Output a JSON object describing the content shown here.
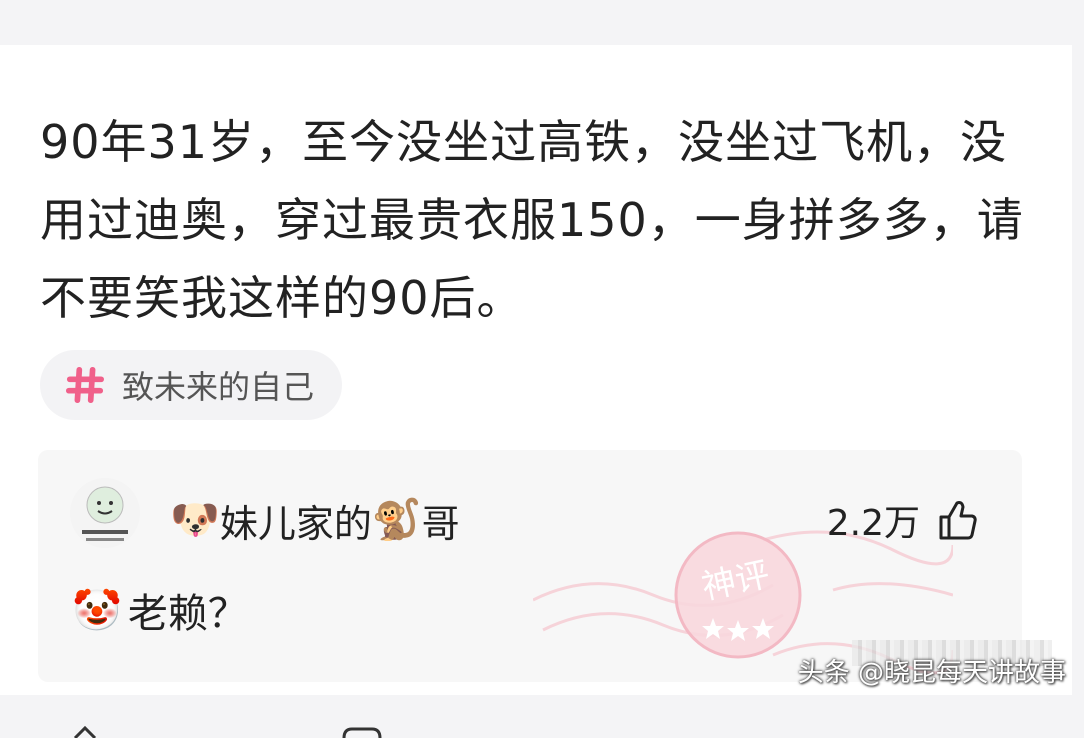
{
  "post": {
    "text": "90年31岁，至今没坐过高铁，没坐过飞机，没用过迪奥，穿过最贵衣服150，一身拼多多，请不要笑我这样的90后。"
  },
  "tag": {
    "icon": "hash-icon",
    "label": "致未来的自己",
    "icon_color": "#f0608a"
  },
  "comment": {
    "avatar": "meme-face-avatar",
    "username_prefix_emoji": "🐶",
    "username_part1": "妹儿家的",
    "username_mid_emoji": "🐒",
    "username_part2": "哥",
    "likes": "2.2万",
    "text_emoji": "🤡",
    "text": "老赖？",
    "stamp_label": "神评"
  },
  "watermark": {
    "text": "头条 @晓昆每天讲故事"
  }
}
